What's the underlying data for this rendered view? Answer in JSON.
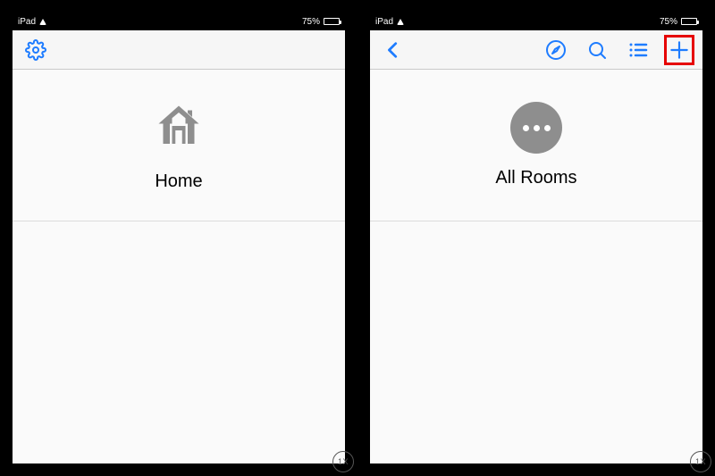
{
  "status": {
    "carrier": "iPad",
    "battery_pct": "75%"
  },
  "left": {
    "tile_label": "Home"
  },
  "right": {
    "tile_label": "All Rooms"
  },
  "badge": "1X",
  "colors": {
    "accent": "#1e7cff",
    "highlight": "#e60000",
    "icon_grey": "#8e8e8e"
  }
}
